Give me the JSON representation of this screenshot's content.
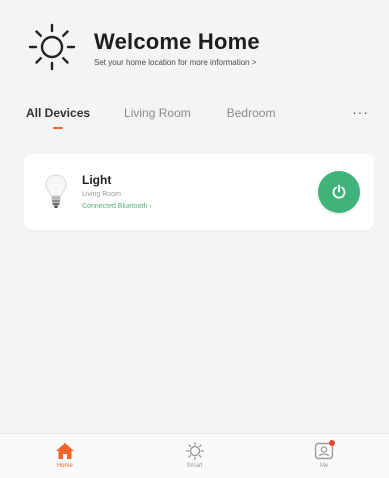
{
  "header": {
    "title": "Welcome Home",
    "subtitle": "Set your home location for more information >"
  },
  "tabs": [
    {
      "label": "All Devices",
      "active": true
    },
    {
      "label": "Living Room",
      "active": false
    },
    {
      "label": "Bedroom",
      "active": false
    }
  ],
  "tabs_more": "···",
  "device": {
    "name": "Light",
    "room": "Living Room",
    "status": "Connected Bluetooth ›",
    "power_color": "#3fb37a"
  },
  "bottom_nav": [
    {
      "label": "Home",
      "icon": "home-icon",
      "active": true
    },
    {
      "label": "Smart",
      "icon": "smart-icon",
      "active": false
    },
    {
      "label": "Me",
      "icon": "me-icon",
      "active": false
    }
  ],
  "colors": {
    "accent": "#f0652a",
    "power": "#3fb37a",
    "badge": "#e8442e"
  }
}
